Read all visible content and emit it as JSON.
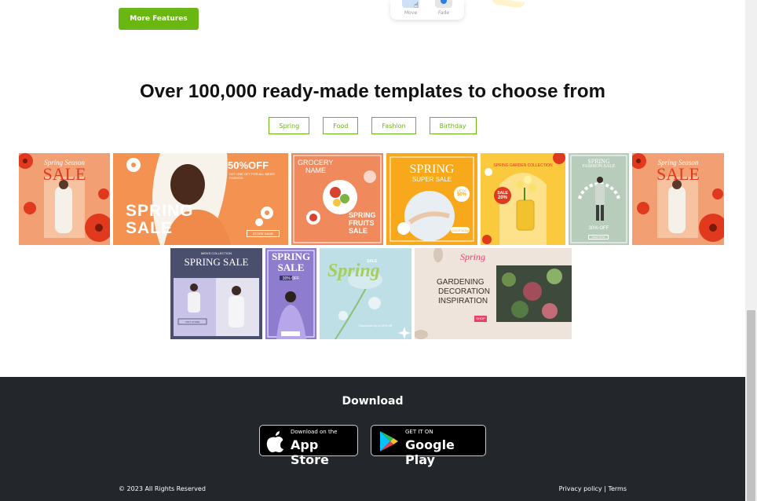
{
  "top": {
    "more_features_label": "More Features",
    "tools": [
      {
        "label": "Move"
      },
      {
        "label": "Fade"
      }
    ]
  },
  "templates": {
    "title": "Over 100,000 ready-made templates to choose from",
    "tags": [
      "Spring",
      "Food",
      "Fashion",
      "Birthday"
    ],
    "tiles": {
      "t1": {
        "line1": "Spring Season",
        "line2": "SALE"
      },
      "t2": {
        "offer": "50%OFF",
        "small": "GET ONE OFF FOR ALL MEN'S FASHION",
        "line1": "SPRING",
        "line2": "SALE",
        "cta": "STORE NAME"
      },
      "t3": {
        "line1": "GROCERY",
        "line2": "NAME",
        "line3": "SPRING",
        "line4": "FRUITS",
        "line5": "SALE"
      },
      "t4": {
        "line1": "SPRING",
        "line2": "SUPER SALE",
        "badge1": "UP TO",
        "badge2": "50%",
        "cta": "SHOP NOW"
      },
      "t5": {
        "line1": "SPRING GARDEN COLLECTION",
        "badge1": "SALE",
        "badge2": "20%"
      },
      "t6": {
        "line1": "SPRING",
        "line2": "FASHION SALE",
        "offer": "30% OFF",
        "cta": "SHOP NOW"
      },
      "t7": {
        "line1": "Spring Season",
        "line2": "SALE"
      },
      "t8": {
        "line1": "MEN'S COLLECTION",
        "line2": "SPRING SALE",
        "cta": "VISIT STORE"
      },
      "t9": {
        "line1": "SPRING",
        "line2": "SALE",
        "offer": "30% OFF"
      },
      "t10": {
        "small": "SALE",
        "line1": "Spring",
        "caption": "Discounts up to 40% off"
      },
      "t11": {
        "script": "Spring",
        "line1": "GARDENING",
        "line2": "DECORATION",
        "line3": "INSPIRATION",
        "cta": "SHOP"
      }
    }
  },
  "footer": {
    "download_title": "Download",
    "app_store": {
      "small": "Download on the",
      "big": "App Store"
    },
    "google_play": {
      "small": "GET IT ON",
      "big": "Google Play"
    },
    "copyright": "© 2023 All Rights Reserved",
    "privacy": "Privacy policy",
    "separator": " | ",
    "terms": "Terms"
  },
  "colors": {
    "accent": "#6ab613",
    "footer_bg": "#23262b",
    "orange": "#f08a4b"
  }
}
